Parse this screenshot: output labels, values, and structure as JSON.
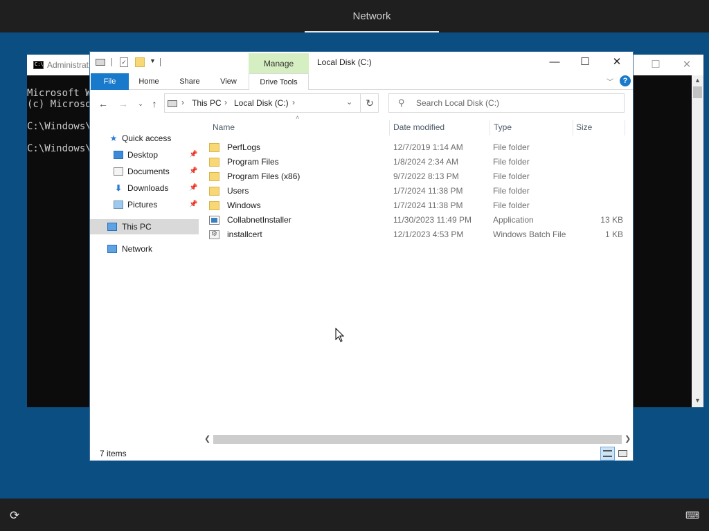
{
  "topbar": {
    "tab_label": "Network"
  },
  "cmd": {
    "title": "Administrat",
    "lines": [
      "Microsoft W",
      "(c) Microso",
      "",
      "C:\\Windows\\",
      "",
      "C:\\Windows\\"
    ]
  },
  "explorer": {
    "title": "Local Disk (C:)",
    "contextual_tab_group": "Manage",
    "tabs": {
      "file": "File",
      "home": "Home",
      "share": "Share",
      "view": "View",
      "drive_tools": "Drive Tools"
    },
    "address": {
      "crumbs": [
        "This PC",
        "Local Disk (C:)"
      ]
    },
    "search": {
      "placeholder": "Search Local Disk (C:)"
    },
    "nav": {
      "quick_access": "Quick access",
      "desktop": "Desktop",
      "documents": "Documents",
      "downloads": "Downloads",
      "pictures": "Pictures",
      "this_pc": "This PC",
      "network": "Network"
    },
    "columns": {
      "name": "Name",
      "date": "Date modified",
      "type": "Type",
      "size": "Size"
    },
    "files": [
      {
        "icon": "folder-icon",
        "name": "PerfLogs",
        "date": "12/7/2019 1:14 AM",
        "type": "File folder",
        "size": ""
      },
      {
        "icon": "folder-icon",
        "name": "Program Files",
        "date": "1/8/2024 2:34 AM",
        "type": "File folder",
        "size": ""
      },
      {
        "icon": "folder-icon",
        "name": "Program Files (x86)",
        "date": "9/7/2022 8:13 PM",
        "type": "File folder",
        "size": ""
      },
      {
        "icon": "folder-icon",
        "name": "Users",
        "date": "1/7/2024 11:38 PM",
        "type": "File folder",
        "size": ""
      },
      {
        "icon": "folder-icon",
        "name": "Windows",
        "date": "1/7/2024 11:38 PM",
        "type": "File folder",
        "size": ""
      },
      {
        "icon": "application-icon",
        "name": "CollabnetInstaller",
        "date": "11/30/2023 11:49 PM",
        "type": "Application",
        "size": "13 KB"
      },
      {
        "icon": "batch-file-icon",
        "name": "installcert",
        "date": "12/1/2023 4:53 PM",
        "type": "Windows Batch File",
        "size": "1 KB"
      }
    ],
    "status": {
      "item_count": "7 items"
    }
  },
  "colors": {
    "desktop_bg": "#0b4f82",
    "file_tab": "#1979ca",
    "manage_band": "#d6efc2",
    "bar_bg": "#1f1f1f"
  }
}
